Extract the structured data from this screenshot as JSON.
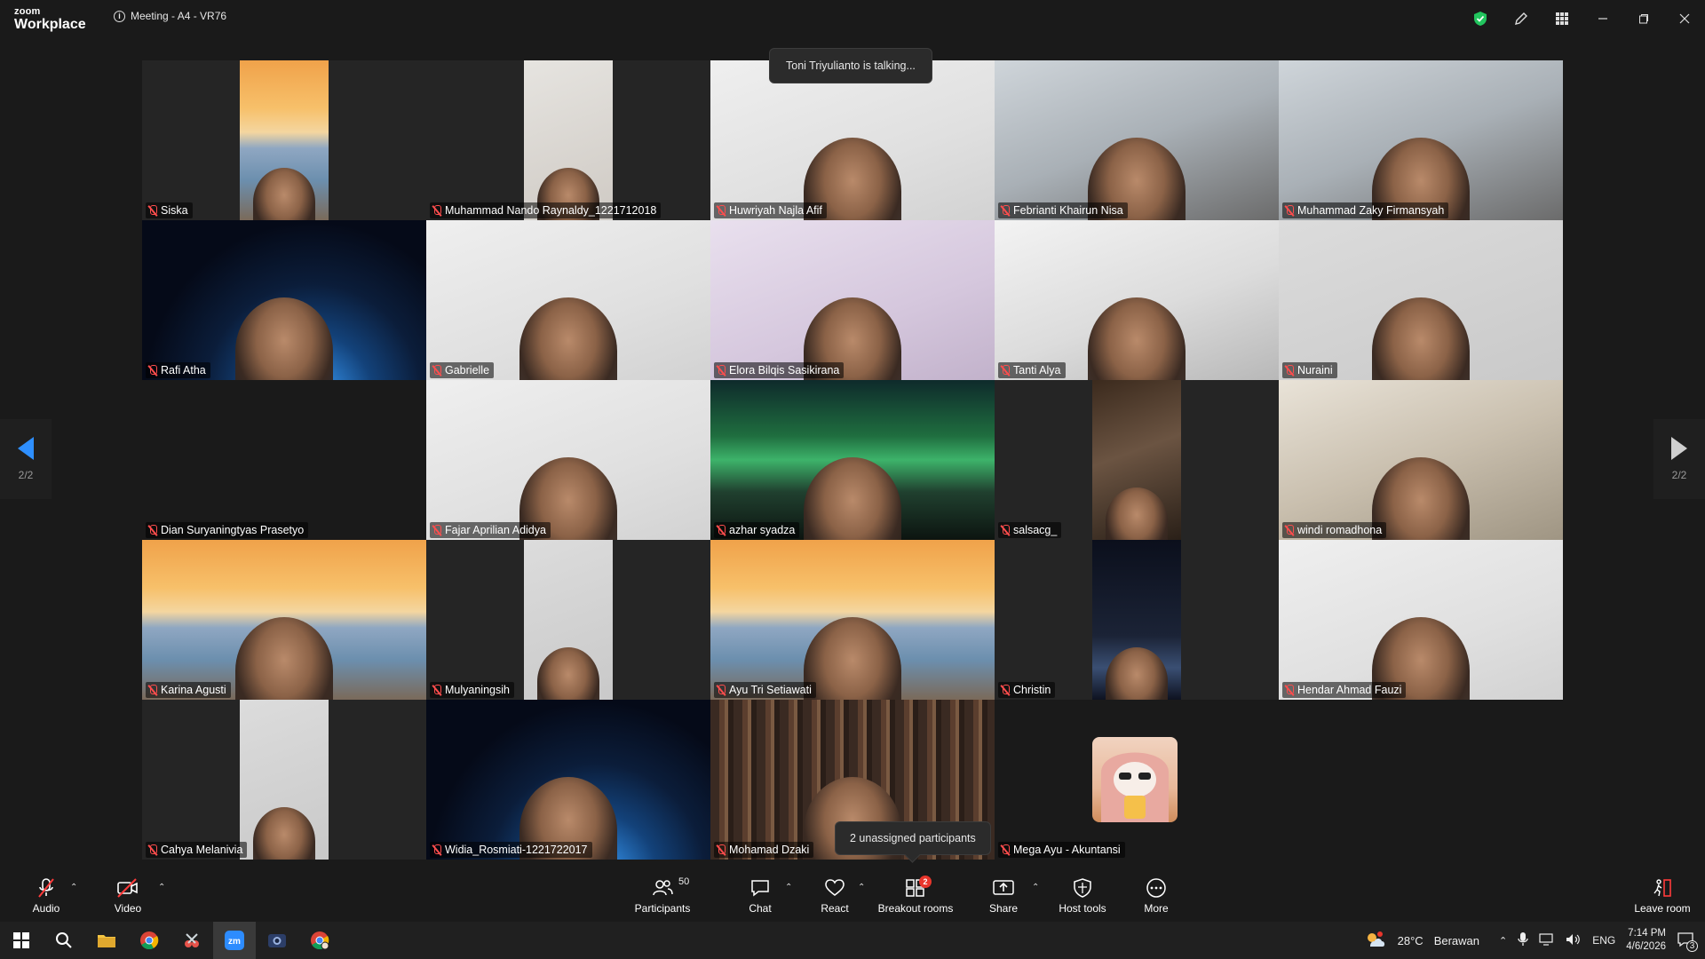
{
  "titlebar": {
    "brand_small": "zoom",
    "brand_big": "Workplace",
    "meeting_title": "Meeting - A4 - VR76",
    "icons": [
      "shield-check-icon",
      "pencil-icon",
      "apps-grid-icon",
      "minimize-icon",
      "restore-icon",
      "close-icon"
    ]
  },
  "stage": {
    "talking_tooltip": "Toni Triyulianto is talking...",
    "unassigned_tooltip": "2 unassigned participants",
    "page_left": "2/2",
    "page_right": "2/2",
    "tiles": [
      {
        "name": "Siska",
        "bg": "bridge",
        "narrow": true
      },
      {
        "name": "Muhammad Nando Raynaldy_1221712018",
        "bg": "wall",
        "narrow": true
      },
      {
        "name": "Huwriyah Najla Afif",
        "bg": "white"
      },
      {
        "name": "Febrianti Khairun Nisa",
        "bg": "room"
      },
      {
        "name": "Muhammad Zaky Firmansyah",
        "bg": "room"
      },
      {
        "name": "Rafi Atha",
        "bg": "space"
      },
      {
        "name": "Gabrielle",
        "bg": "white"
      },
      {
        "name": "Elora Bilqis Sasikirana",
        "bg": "lilac"
      },
      {
        "name": "Tanti Alya",
        "bg": "office"
      },
      {
        "name": "Nuraini",
        "bg": "grey"
      },
      {
        "name": "Dian Suryaningtyas Prasetyo",
        "bg": "empty"
      },
      {
        "name": "Fajar Aprilian Adidya",
        "bg": "white"
      },
      {
        "name": "azhar syadza",
        "bg": "aurora"
      },
      {
        "name": "salsacg_",
        "bg": "cabinet",
        "narrow": true
      },
      {
        "name": "windi romadhona",
        "bg": "window"
      },
      {
        "name": "Karina Agusti",
        "bg": "bridge"
      },
      {
        "name": "Mulyaningsih",
        "bg": "grey",
        "narrow": true
      },
      {
        "name": "Ayu Tri Setiawati",
        "bg": "bridge"
      },
      {
        "name": "Christin",
        "bg": "city",
        "narrow": true
      },
      {
        "name": "Hendar Ahmad Fauzi",
        "bg": "white"
      },
      {
        "name": "Cahya Melanivia",
        "bg": "grey",
        "narrow": true
      },
      {
        "name": "Widia_Rosmiati-1221722017",
        "bg": "space"
      },
      {
        "name": "Mohamad Dzaki",
        "bg": "library"
      },
      {
        "name": "Mega Ayu - Akuntansi",
        "bg": "avatar"
      },
      {
        "name": "",
        "bg": "empty"
      }
    ]
  },
  "toolbar": {
    "audio": "Audio",
    "video": "Video",
    "participants": "Participants",
    "participants_count": "50",
    "chat": "Chat",
    "react": "React",
    "breakout": "Breakout rooms",
    "breakout_badge": "2",
    "share": "Share",
    "host_tools": "Host tools",
    "more": "More",
    "leave": "Leave room"
  },
  "taskbar": {
    "weather_temp": "28°C",
    "weather_text": "Berawan",
    "lang": "ENG",
    "time": "7:14 PM",
    "date": "4/6/2026",
    "notif_count": "3"
  }
}
